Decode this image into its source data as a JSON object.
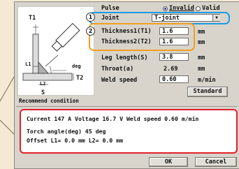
{
  "diagram": {
    "t1_label": "T1",
    "t2_label": "T2",
    "s_label": "S",
    "l1_label": "L1",
    "l2_label": "L2",
    "deg_label": "deg"
  },
  "pulse": {
    "label": "Pulse",
    "option_invalid": "Invalid",
    "option_valid": "Valid",
    "selected": "Invalid"
  },
  "joint": {
    "badge": "1",
    "label": "Joint",
    "value": "T-joint"
  },
  "thickness": {
    "badge": "2",
    "t1_label": "Thickness1(T1)",
    "t1_value": "1.6",
    "t1_unit": "mm",
    "t2_label": "Thickness2(T2)",
    "t2_value": "1.6",
    "t2_unit": "mm"
  },
  "leg": {
    "label": "Leg length(S)",
    "value": "3.8",
    "unit": "mm"
  },
  "throat": {
    "label": "Throat(a)",
    "value": "2.69",
    "unit": "mm"
  },
  "weld_speed": {
    "label": "Weld speed",
    "value": "0.60",
    "unit": "m/min"
  },
  "standard_button": "Standard",
  "recommend": {
    "label": "Recommend condition",
    "line1": "Current 147 A  Voltage 16.7 V Weld speed  0.60 m/min",
    "line2": "Torch angle(deg)  45 deg",
    "line3": "Offset  L1=  0.0 mm  L2=  0.0 mm"
  },
  "ok_button": "OK",
  "cancel_button": "Cancel",
  "colors": {
    "highlight_blue": "#1e9be0",
    "highlight_orange": "#f0a020",
    "highlight_red": "#e0202a",
    "callout_bg": "#f4ead3"
  }
}
